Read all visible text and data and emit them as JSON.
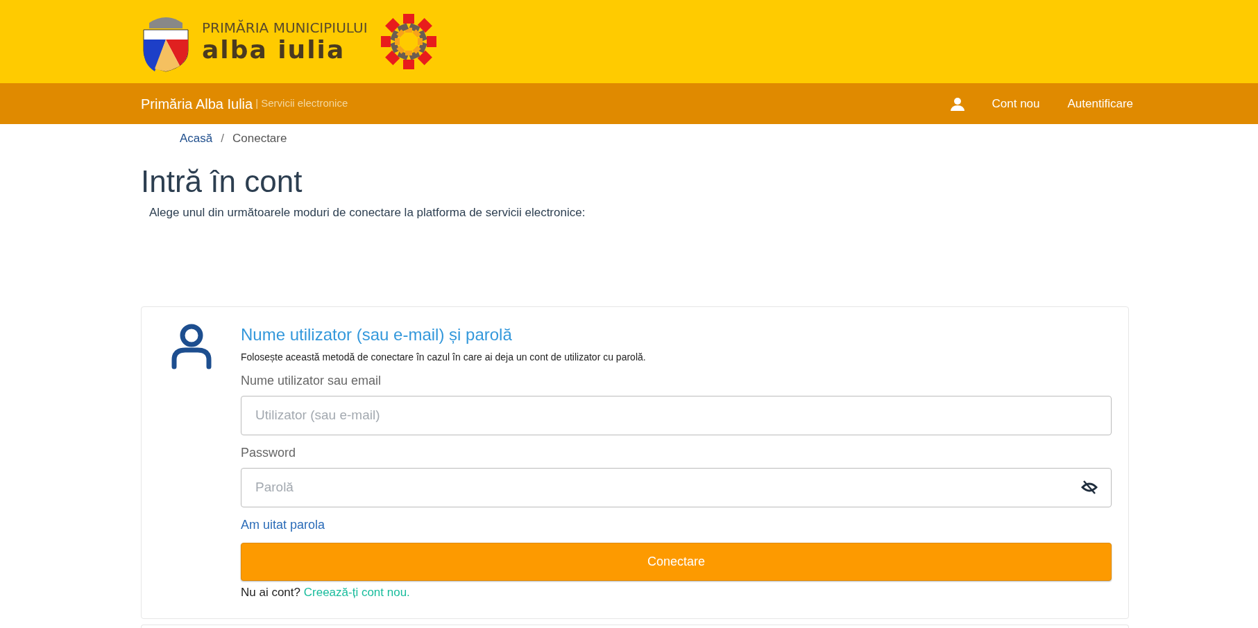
{
  "header": {
    "logo_top": "PRIMĂRIA MUNICIPIULUI",
    "logo_bottom": "alba iulia"
  },
  "navbar": {
    "brand": "Primăria Alba Iulia",
    "tagline": "| Servicii electronice",
    "links": [
      "Cont nou",
      "Autentificare"
    ]
  },
  "breadcrumb": [
    {
      "label": "Acasă",
      "selected": false
    },
    {
      "label": "Conectare",
      "selected": true
    }
  ],
  "breadcrumb_separator": "/",
  "page": {
    "title": "Intră în cont",
    "intro": "Alege unul din următoarele moduri de conectare la platforma de servicii electronice:"
  },
  "login_card": {
    "heading": "Nume utilizator (sau e-mail) și parolă",
    "description": "Folosește această metodă de conectare în cazul în care ai deja un cont de utilizator cu parolă.",
    "fields": [
      {
        "kind": "text",
        "label": "Nume utilizator sau email",
        "placeholder": "Utilizator (sau e-mail)"
      },
      {
        "kind": "password",
        "label": "Password",
        "placeholder": "Parolă"
      }
    ],
    "forgot_link": "Am uitat parola",
    "submit": "Conectare",
    "signup_prompt": "Nu ai cont?",
    "signup_link": "Creează-ți cont nou."
  }
}
